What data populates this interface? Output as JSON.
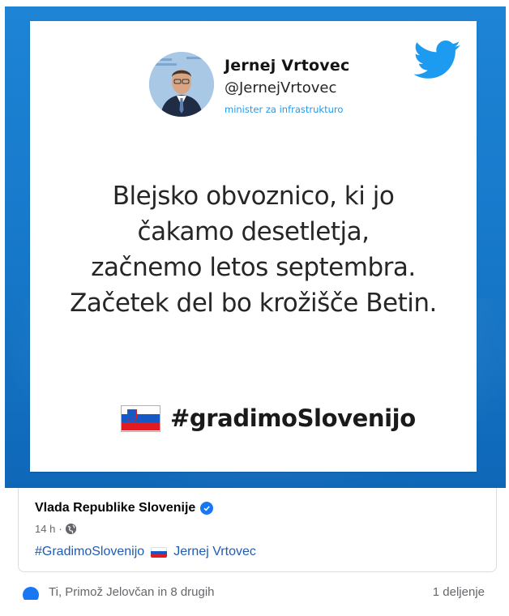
{
  "tweet": {
    "author_name": "Jernej Vrtovec",
    "author_handle": "@JernejVrtovec",
    "author_role": "minister za infrastrukturo",
    "text_lines": [
      "Blejsko obvoznico, ki jo",
      "čakamo desetletja,",
      "začnemo letos septembra.",
      "Začetek del bo krožišče Betin."
    ],
    "hashtag": "#gradimoSlovenijo",
    "logo_icon": "twitter-bird-icon",
    "brand_color": "#1d9bf0"
  },
  "post": {
    "page_name": "Vlada Republike Slovenije",
    "time": "14 h",
    "separator": "·",
    "audience_icon": "globe-icon",
    "hashtag_link": "#GradimoSlovenijo",
    "mention_link": "Jernej Vrtovec",
    "link_color": "#1e5bb8"
  },
  "footer": {
    "reactions_text": "Ti, Primož Jelovčan in 8 drugih",
    "shares_text": "1 deljenje"
  }
}
